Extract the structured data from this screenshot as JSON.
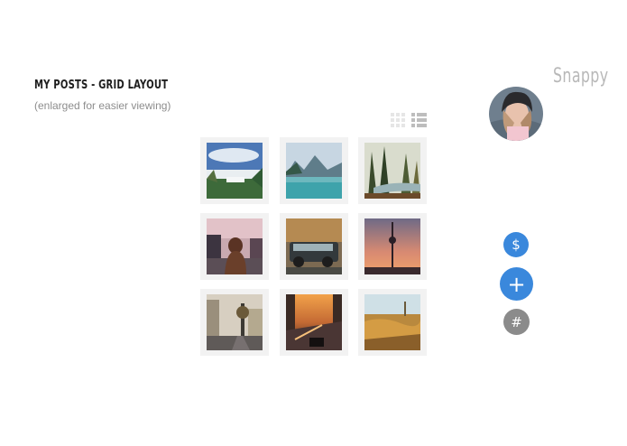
{
  "header": {
    "title": "My Posts - Grid Layout",
    "subtitle": "(enlarged for easier viewing)",
    "brand": "Snappy"
  },
  "view_toggle": {
    "options": [
      "grid-view-icon",
      "list-view-icon"
    ]
  },
  "posts": [
    {
      "name": "post-waterfall",
      "alt": "waterfall"
    },
    {
      "name": "post-mountain-lake",
      "alt": "mountain lake"
    },
    {
      "name": "post-forest-river",
      "alt": "forest river"
    },
    {
      "name": "post-woman-street",
      "alt": "woman on street"
    },
    {
      "name": "post-car-street",
      "alt": "car on street"
    },
    {
      "name": "post-tv-tower-sunset",
      "alt": "tv tower at sunset"
    },
    {
      "name": "post-city-sunset-street",
      "alt": "city street at sunset"
    },
    {
      "name": "post-road-motorbike",
      "alt": "road from motorbike"
    },
    {
      "name": "post-wheat-field",
      "alt": "wheat field"
    }
  ],
  "actions": {
    "dollar": "$",
    "add": "+",
    "hash": "#"
  },
  "colors": {
    "accent": "#3a88dc",
    "neutral": "#8b8b8b",
    "tile_frame": "#f2f2f2"
  }
}
